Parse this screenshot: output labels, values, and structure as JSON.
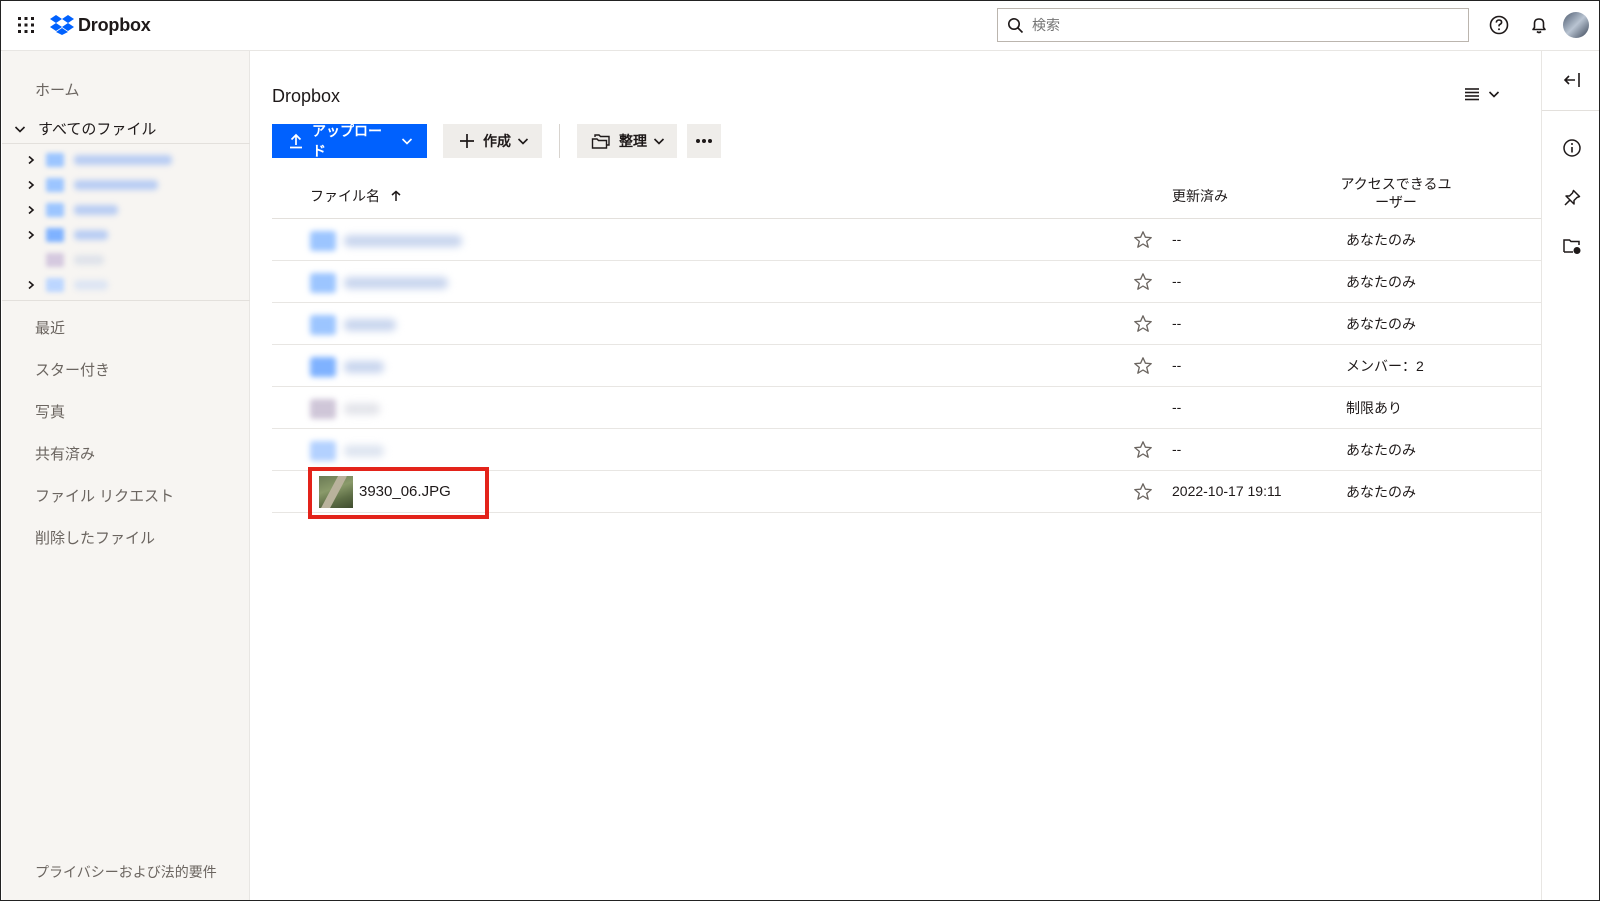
{
  "header": {
    "brand": "Dropbox",
    "search_placeholder": "検索"
  },
  "sidebar": {
    "home": "ホーム",
    "all_files": "すべてのファイル",
    "recent": "最近",
    "starred": "スター付き",
    "photos": "写真",
    "shared": "共有済み",
    "file_requests": "ファイル リクエスト",
    "deleted_files": "削除したファイル",
    "footer": "プライバシーおよび法的要件"
  },
  "main": {
    "title": "Dropbox",
    "toolbar": {
      "upload": "アップロード",
      "create": "作成",
      "organize": "整理"
    },
    "columns": {
      "name": "ファイル名",
      "modified": "更新済み",
      "access": "アクセスできるユーザー"
    },
    "rows": [
      {
        "modified": "--",
        "access": "あなたのみ"
      },
      {
        "modified": "--",
        "access": "あなたのみ"
      },
      {
        "modified": "--",
        "access": "あなたのみ"
      },
      {
        "modified": "--",
        "access": "メンバー：2"
      },
      {
        "modified": "--",
        "access": "制限あり"
      },
      {
        "modified": "--",
        "access": "あなたのみ"
      },
      {
        "name": "3930_06.JPG",
        "modified": "2022-10-17 19:11",
        "access": "あなたのみ"
      }
    ]
  },
  "colors": {
    "primary": "#0061fe",
    "sidebar_bg": "#f7f5f2",
    "highlight": "#e3231a"
  }
}
